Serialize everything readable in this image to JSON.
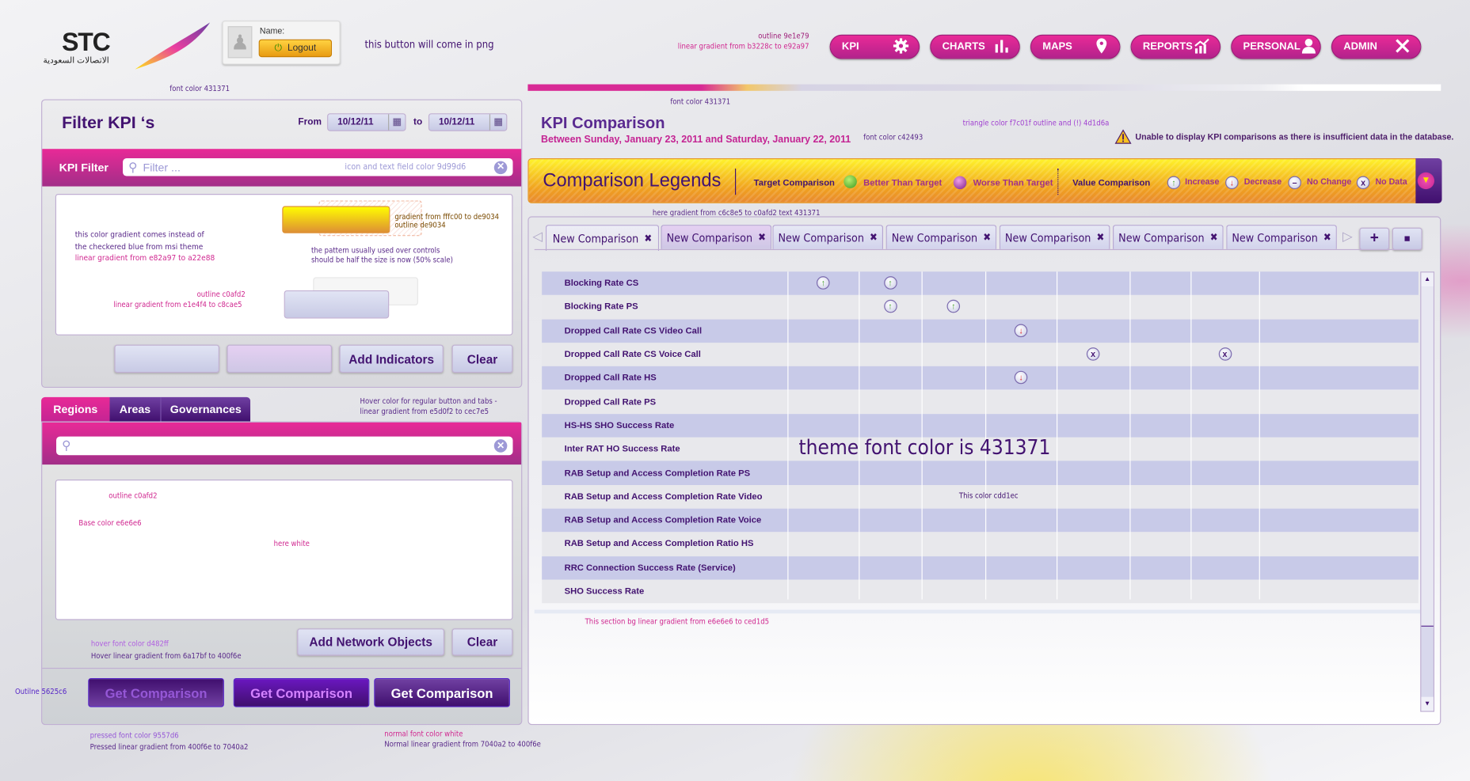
{
  "header": {
    "logo_text": "STC",
    "logo_arabic": "الاتصالات السعودية",
    "user_label": "Name:",
    "logout_label": "Logout",
    "png_note": "this button will come in png"
  },
  "nav": {
    "annotation_outline": "outline 9e1e79",
    "annotation_gradient": "linear gradient from b3228c to e92a97",
    "items": [
      {
        "label": "KPI",
        "icon": "gear-icon"
      },
      {
        "label": "CHARTS",
        "icon": "bar-chart-icon"
      },
      {
        "label": "MAPS",
        "icon": "map-pin-icon"
      },
      {
        "label": "REPORTS",
        "icon": "trend-chart-icon"
      },
      {
        "label": "PERSONAL",
        "icon": "user-icon"
      },
      {
        "label": "ADMIN",
        "icon": "tools-icon"
      }
    ]
  },
  "filter_panel": {
    "title": "Filter KPI ‘s",
    "from_label": "From",
    "to_label": "to",
    "from_date": "10/12/11",
    "to_date": "10/12/11",
    "bar_label": "KPI Filter",
    "search_placeholder": "Filter ...",
    "add_button": "Add Indicators",
    "clear_button": "Clear"
  },
  "network_panel": {
    "tabs": [
      {
        "label": "Regions"
      },
      {
        "label": "Areas"
      },
      {
        "label": "Governances"
      }
    ],
    "add_button": "Add Network Objects",
    "clear_button": "Clear",
    "get_buttons": [
      "Get Comparison",
      "Get Comparison",
      "Get Comparison"
    ]
  },
  "annotations": {
    "font_color_left": "font color 431371",
    "search_color": "icon and text field color 9d99d6",
    "gradient_note_1": "this color gradient  comes instead of",
    "gradient_note_2": "the checkered blue from msi theme",
    "gradient_note_3": "linear gradient from e82a97 to a22e88",
    "yellow_1": "gradient from fffc00 to de9034",
    "yellow_2": "outline de9034",
    "pattern_1": "the pattern usually used over controls",
    "pattern_2": "should be half the size is now (50% scale)",
    "outline_1": "outline c0afd2",
    "outline_grad": "linear gradient from e1e4f4 to c8cae5",
    "hover_1": "Hover color for regular button and tabs -",
    "hover_2": "linear gradient from e5d0f2 to cec7e5",
    "outline_2": "outline c0afd2",
    "base_color": "Base color e6e6e6",
    "here_white": "here white",
    "hover_font": "hover font color d482ff",
    "hover_grad": "Hover linear gradient from 6a17bf to 400f6e",
    "outline_btn": "Outilne 5625c6",
    "pressed_font": "pressed font color 9557d6",
    "pressed_grad": "Pressed linear gradient from  400f6e to 7040a2",
    "normal_font": "normal font color white",
    "normal_grad": "Normal linear gradient from 7040a2 to 400f6e",
    "font_color_right": "font color 431371",
    "font_color_pink": "font color c42493",
    "triangle": "triangle color f7c01f outline and (!)  4d1d6a",
    "tab_grad": "here gradient from c6c8e5 to c0afd2 text 431371",
    "theme_font": "theme  font color is 431371",
    "row_color": "This color cdd1ec",
    "section_bg": "This section bg linear gradient from e6e6e6 to ced1d5"
  },
  "comparison": {
    "title": "KPI Comparison",
    "subtitle": "Between Sunday, January 23, 2011 and Saturday, January 22, 2011",
    "warning": "Unable to display KPI comparisons as there is insufficient data in the database.",
    "legend": {
      "title": "Comparison Legends",
      "target_label": "Target Comparison",
      "better": "Better Than Target",
      "worse": "Worse Than Target",
      "value_label": "Value Comparison",
      "increase": "Increase",
      "decrease": "Decrease",
      "no_change": "No Change",
      "no_data": "No Data"
    },
    "tabs": [
      "New Comparison",
      "New Comparison",
      "New Comparison",
      "New Comparison",
      "New Comparison",
      "New Comparison",
      "New Comparison"
    ],
    "rows": [
      {
        "label": "Blocking Rate CS",
        "cells": [
          "increase",
          "increase",
          "",
          "",
          "",
          "",
          "",
          ""
        ]
      },
      {
        "label": "Blocking Rate PS",
        "cells": [
          "",
          "increase",
          "increase",
          "",
          "",
          "",
          "",
          ""
        ]
      },
      {
        "label": "Dropped Call Rate CS Video Call",
        "cells": [
          "",
          "",
          "",
          "decrease",
          "",
          "",
          "",
          ""
        ]
      },
      {
        "label": "Dropped Call Rate CS Voice Call",
        "cells": [
          "",
          "",
          "",
          "",
          "no-data",
          "",
          "no-data",
          ""
        ]
      },
      {
        "label": "Dropped Call Rate HS",
        "cells": [
          "",
          "",
          "",
          "decrease",
          "",
          "",
          "",
          ""
        ]
      },
      {
        "label": "Dropped Call Rate PS",
        "cells": [
          "",
          "",
          "",
          "",
          "",
          "",
          "",
          ""
        ]
      },
      {
        "label": "HS-HS SHO Success Rate",
        "cells": [
          "",
          "",
          "",
          "",
          "",
          "",
          "",
          ""
        ]
      },
      {
        "label": "Inter RAT HO Success Rate",
        "cells": [
          "",
          "",
          "",
          "",
          "",
          "",
          "",
          ""
        ]
      },
      {
        "label": "RAB Setup and Access Completion Rate PS",
        "cells": [
          "",
          "",
          "",
          "",
          "",
          "",
          "",
          ""
        ]
      },
      {
        "label": "RAB Setup and Access Completion Rate Video",
        "cells": [
          "",
          "",
          "",
          "",
          "",
          "",
          "",
          ""
        ]
      },
      {
        "label": "RAB Setup and Access Completion Rate Voice",
        "cells": [
          "",
          "",
          "",
          "",
          "",
          "",
          "",
          ""
        ]
      },
      {
        "label": "RAB Setup and Access Completion Ratio HS",
        "cells": [
          "",
          "",
          "",
          "",
          "",
          "",
          "",
          ""
        ]
      },
      {
        "label": "RRC Connection Success Rate (Service)",
        "cells": [
          "",
          "",
          "",
          "",
          "",
          "",
          "",
          ""
        ]
      },
      {
        "label": "SHO Success Rate",
        "cells": [
          "",
          "",
          "",
          "",
          "",
          "",
          "",
          ""
        ]
      }
    ]
  },
  "colors": {
    "theme": "#431371",
    "pink": "#c42493",
    "nav_from": "#b3228c",
    "nav_to": "#e92a97"
  }
}
